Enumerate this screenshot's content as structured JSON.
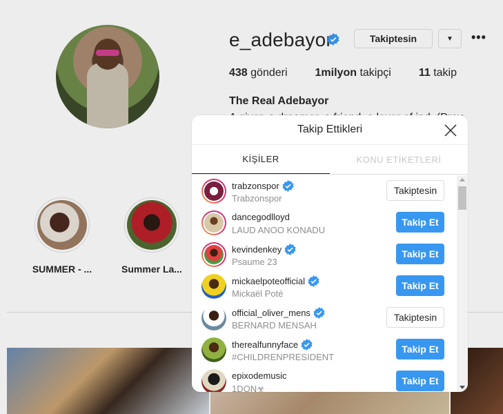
{
  "profile": {
    "username": "e_adebayor",
    "follow_button": "Takiptesin",
    "dropdown_icon": "caret-down-icon",
    "more_icon": "more-dots-icon",
    "stats": {
      "posts_count": "438",
      "posts_label": "gönderi",
      "followers_count": "1milyon",
      "followers_label": "takipçi",
      "following_count": "11",
      "following_label": "takip"
    },
    "full_name": "The Real Adebayor",
    "bio": "A giver, a dreamer, a friend, a lover of ind. (Prov",
    "highlights": [
      {
        "label": "SUMMER - ..."
      },
      {
        "label": "Summer La..."
      }
    ]
  },
  "modal": {
    "title": "Takip Ettikleri",
    "tabs": [
      {
        "label": "KİŞİLER",
        "active": true
      },
      {
        "label": "KONU ETİKETLERİ",
        "active": false
      }
    ],
    "rows": [
      {
        "username": "trabzonspor",
        "subtitle": "Trabzonspor",
        "verified": true,
        "button": "Takiptesin",
        "following": true,
        "story": true
      },
      {
        "username": "dancegodlloyd",
        "subtitle": "LAUD ANOO KONADU",
        "verified": false,
        "button": "Takip Et",
        "following": false,
        "story": true
      },
      {
        "username": "kevindenkey",
        "subtitle": "Psaume 23",
        "verified": true,
        "button": "Takip Et",
        "following": false,
        "story": true
      },
      {
        "username": "mickaelpoteofficial",
        "subtitle": "Mickaël Poté",
        "verified": true,
        "button": "Takip Et",
        "following": false,
        "story": false
      },
      {
        "username": "official_oliver_mens",
        "subtitle": "BERNARD MENSAH",
        "verified": true,
        "button": "Takiptesin",
        "following": true,
        "story": false
      },
      {
        "username": "therealfunnyface",
        "subtitle": "#CHILDRENPRESIDENT",
        "verified": true,
        "button": "Takip Et",
        "following": false,
        "story": false
      },
      {
        "username": "epixodemusic",
        "subtitle": "1DON☣",
        "verified": false,
        "button": "Takip Et",
        "following": false,
        "story": false
      }
    ]
  },
  "colors": {
    "accent_blue": "#3897f0",
    "verified_blue": "#3897f0",
    "muted_text": "#8e8e8e"
  }
}
